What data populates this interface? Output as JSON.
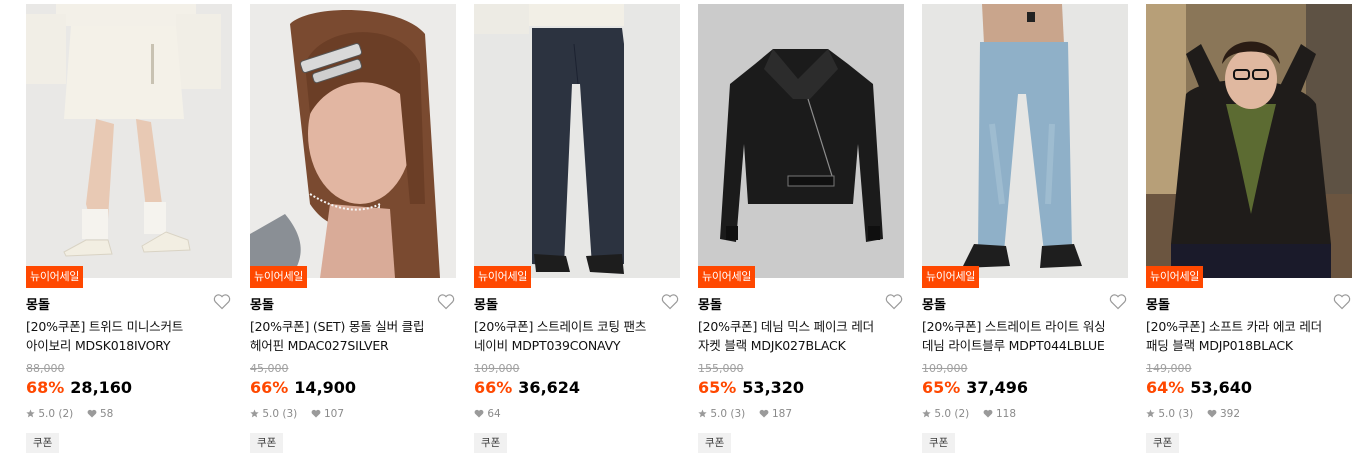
{
  "colors": {
    "accent": "#ff4800",
    "badge_bg": "#ff4800",
    "strike_text": "#a0a0a0",
    "meta_text": "#8a8a8a",
    "coupon_bg": "#f1f1f1"
  },
  "products": [
    {
      "image_icon": "product-photo-tweed-skirt",
      "badge": "뉴이어세일",
      "brand": "몽돌",
      "name_line1": "[20%쿠폰] 트위드 미니스커트",
      "name_line2": "아이보리 MDSK018IVORY",
      "original_price": "88,000",
      "discount": "68%",
      "price": "28,160",
      "rating": "5.0 (2)",
      "likes": "58",
      "coupon": "쿠폰"
    },
    {
      "image_icon": "product-photo-hair-pin",
      "badge": "뉴이어세일",
      "brand": "몽돌",
      "name_line1": "[20%쿠폰] (SET) 몽돌 실버 클립",
      "name_line2": "헤어핀 MDAC027SILVER",
      "original_price": "45,000",
      "discount": "66%",
      "price": "14,900",
      "rating": "5.0 (3)",
      "likes": "107",
      "coupon": "쿠폰"
    },
    {
      "image_icon": "product-photo-coated-pants",
      "badge": "뉴이어세일",
      "brand": "몽돌",
      "name_line1": "[20%쿠폰] 스트레이트 코팅 팬츠",
      "name_line2": "네이비 MDPT039CONAVY",
      "original_price": "109,000",
      "discount": "66%",
      "price": "36,624",
      "rating": "",
      "likes": "64",
      "coupon": "쿠폰"
    },
    {
      "image_icon": "product-photo-leather-jacket",
      "badge": "뉴이어세일",
      "brand": "몽돌",
      "name_line1": "[20%쿠폰] 데님 믹스 페이크 레더",
      "name_line2": "자켓 블랙 MDJK027BLACK",
      "original_price": "155,000",
      "discount": "65%",
      "price": "53,320",
      "rating": "5.0 (3)",
      "likes": "187",
      "coupon": "쿠폰"
    },
    {
      "image_icon": "product-photo-denim-pants",
      "badge": "뉴이어세일",
      "brand": "몽돌",
      "name_line1": "[20%쿠폰] 스트레이트 라이트 워싱",
      "name_line2": "데님 라이트블루 MDPT044LBLUE",
      "original_price": "109,000",
      "discount": "65%",
      "price": "37,496",
      "rating": "5.0 (2)",
      "likes": "118",
      "coupon": "쿠폰"
    },
    {
      "image_icon": "product-photo-padded-jacket",
      "badge": "뉴이어세일",
      "brand": "몽돌",
      "name_line1": "[20%쿠폰] 소프트 카라 에코 레더",
      "name_line2": "패딩 블랙 MDJP018BLACK",
      "original_price": "149,000",
      "discount": "64%",
      "price": "53,640",
      "rating": "5.0 (3)",
      "likes": "392",
      "coupon": "쿠폰"
    }
  ]
}
